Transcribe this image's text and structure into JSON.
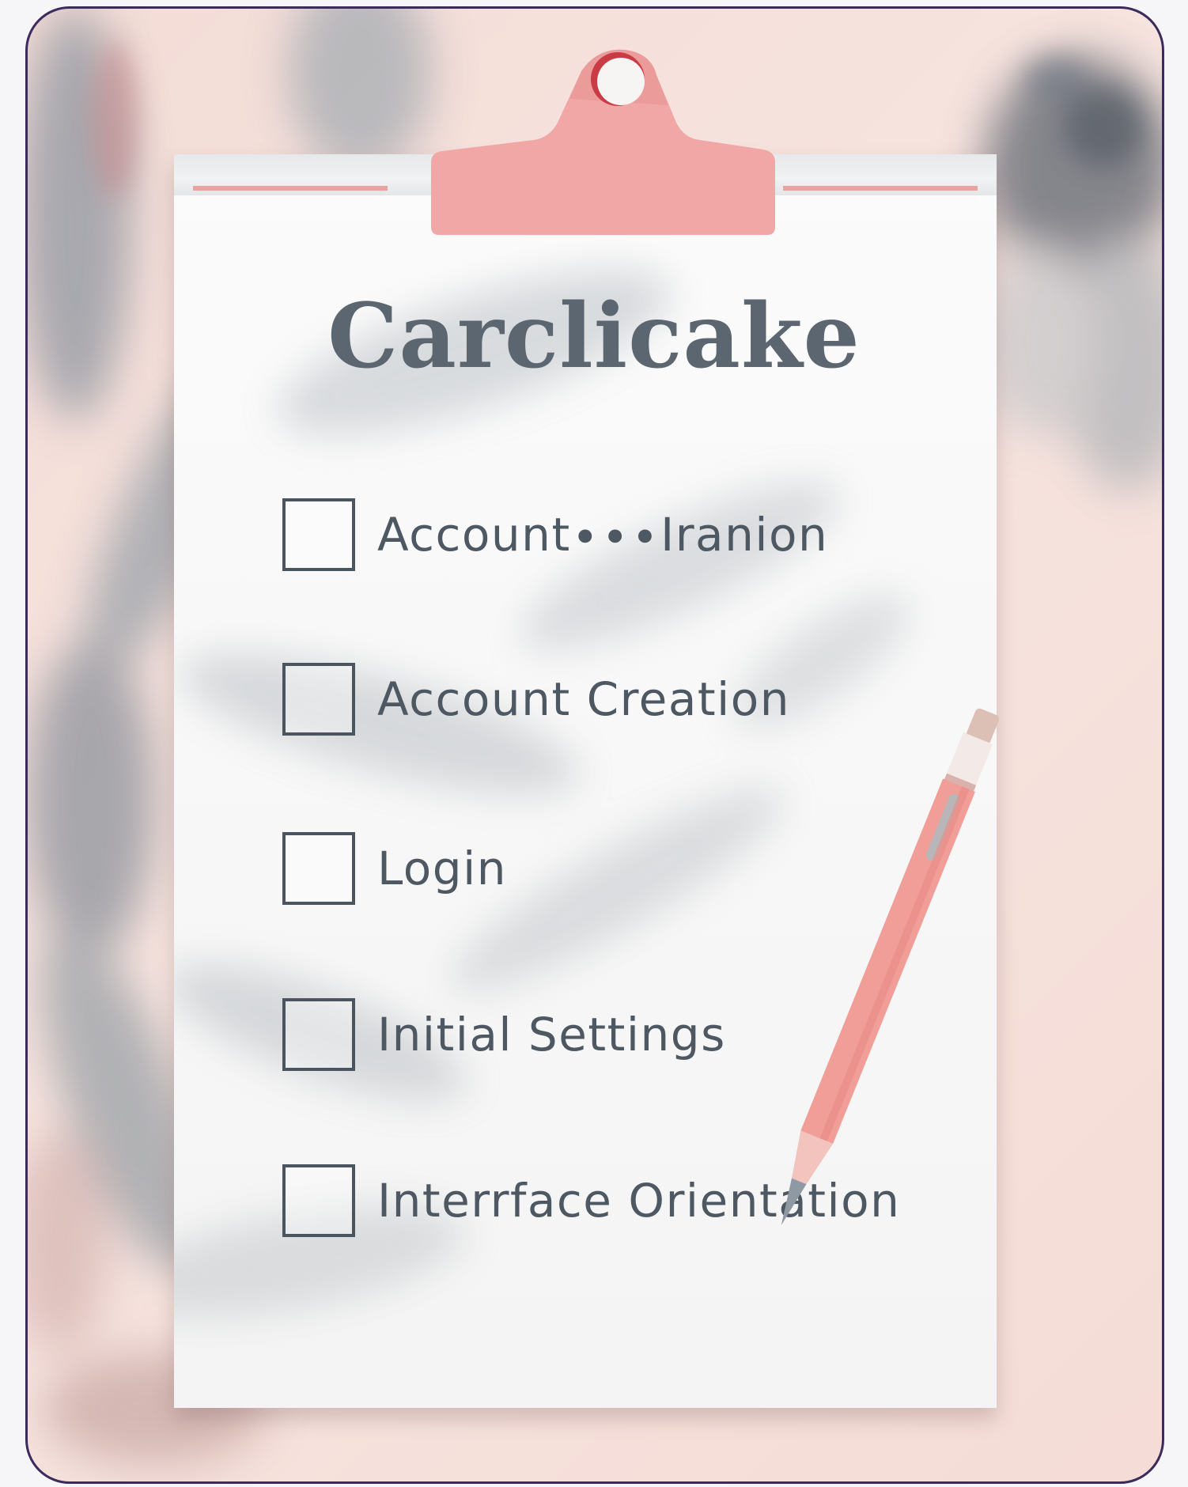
{
  "title": "Carclicake",
  "checklist": {
    "items": [
      {
        "label": "Account∙∙∙Iranion",
        "checked": false
      },
      {
        "label": "Account Creation",
        "checked": false
      },
      {
        "label": "Login",
        "checked": false
      },
      {
        "label": "Initial Settings",
        "checked": false
      },
      {
        "label": "Interrface Orientation",
        "checked": false
      }
    ]
  },
  "colors": {
    "background": "#f5dfd9",
    "clip": "#f0a7a5",
    "pencil": "#f19e98",
    "text": "#4d5862",
    "frame_border": "#3b2a5c"
  },
  "icons": [
    "clipboard-clip-icon",
    "pencil-icon",
    "checkbox-icon"
  ]
}
